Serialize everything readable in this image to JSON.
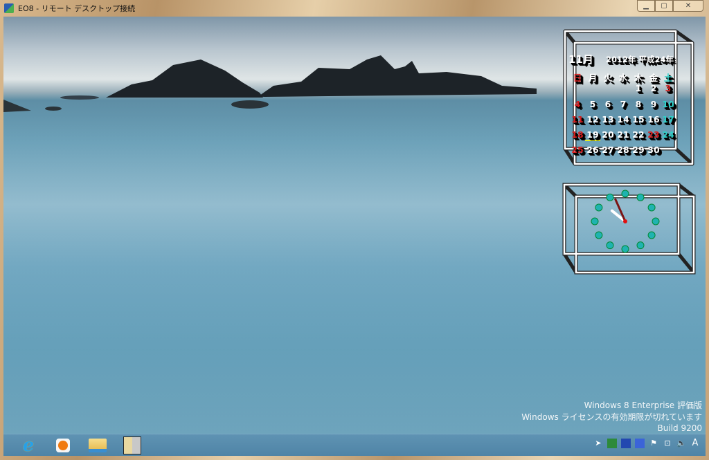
{
  "window": {
    "title": "EO8 - リモート デスクトップ接続",
    "minimize": "▁",
    "maximize": "▢",
    "close": "✕"
  },
  "calendar": {
    "month": "11月",
    "year": "2012年 平成24年",
    "weekdays": [
      "日",
      "月",
      "火",
      "水",
      "木",
      "金",
      "土"
    ],
    "weeks": [
      [
        "",
        "",
        "",
        "",
        "1",
        "2",
        "3"
      ],
      [
        "4",
        "5",
        "6",
        "7",
        "8",
        "9",
        "10"
      ],
      [
        "11",
        "12",
        "13",
        "14",
        "15",
        "16",
        "17"
      ],
      [
        "18",
        "19",
        "20",
        "21",
        "22",
        "23",
        "24"
      ],
      [
        "25",
        "26",
        "27",
        "28",
        "29",
        "30",
        ""
      ]
    ],
    "today": "19",
    "holidays": [
      "3",
      "23"
    ],
    "colors": {
      "sunday": "#d51d1d",
      "saturday": "#2fd0c8",
      "today": "#e8f020"
    }
  },
  "clock": {
    "hour": 10,
    "minute": 56
  },
  "watermark": {
    "line1": "Windows 8 Enterprise 評価版",
    "line2": "Windows ライセンスの有効期限が切れています",
    "line3": "Build 9200"
  },
  "taskbar": {
    "apps": [
      "internet-explorer",
      "windows-media-player",
      "file-explorer",
      "remote-desktop"
    ],
    "tray_ime": "A"
  }
}
